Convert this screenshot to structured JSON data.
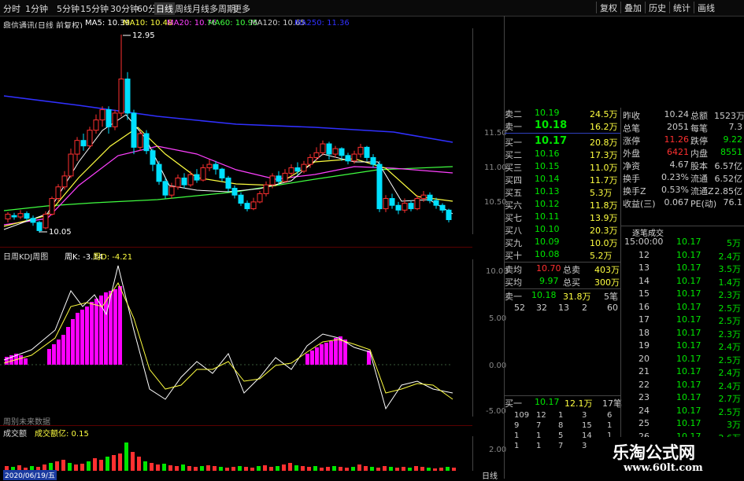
{
  "toolbar": {
    "periods": [
      "分时",
      "1分钟",
      "5分钟",
      "15分钟",
      "30分钟",
      "60分钟",
      "日线",
      "周线",
      "月线",
      "多周期",
      "更多"
    ],
    "active_period": "日线",
    "right_buttons": [
      "复权",
      "叠加",
      "历史",
      "统计",
      "画线"
    ]
  },
  "main_chart": {
    "title": "鼎信通讯(日线 前复权)",
    "ma_labels": [
      {
        "text": "MA5: 10.39",
        "color": "#ffffff"
      },
      {
        "text": "MA10: 10.48",
        "color": "#ffff40"
      },
      {
        "text": "MA20: 10.76",
        "color": "#ff40ff"
      },
      {
        "text": "MA60: 10.95",
        "color": "#40ff40"
      },
      {
        "text": "MA120: 10.65",
        "color": "#cccccc"
      },
      {
        "text": "MA250: 11.36",
        "color": "#3030ff"
      }
    ],
    "high_label": "12.95",
    "low_label": "10.05",
    "y_ticks": [
      "11.50",
      "11.00",
      "10.50"
    ],
    "colors": {
      "up": "#ff3030",
      "down": "#00e0ff",
      "ma5": "#ffffff",
      "ma10": "#ffff40",
      "ma20": "#ff40ff",
      "ma60": "#40ff40",
      "ma250": "#3030ff"
    }
  },
  "kdj": {
    "title": "日周KDJ周图",
    "k_label": "周K: -3.14",
    "d_label": "周D: -4.21",
    "y_ticks": [
      "10.00",
      "5.00",
      "0.00",
      "-5.00"
    ],
    "footer": "周别未来数据"
  },
  "volume": {
    "title": "成交额",
    "sub_label": "成交额亿: 0.15",
    "y_tick": "2.00",
    "date_label": "2020/06/19/五"
  },
  "order_book": {
    "asks": [
      {
        "label": "卖二",
        "price": "10.19",
        "vol": "24.5万"
      },
      {
        "label": "卖一",
        "price": "10.18",
        "vol": "16.2万"
      }
    ],
    "bids": [
      {
        "label": "买一",
        "price": "10.17",
        "vol": "20.8万"
      },
      {
        "label": "买二",
        "price": "10.16",
        "vol": "17.3万"
      },
      {
        "label": "买三",
        "price": "10.15",
        "vol": "11.0万"
      },
      {
        "label": "买四",
        "price": "10.14",
        "vol": "11.7万"
      },
      {
        "label": "买五",
        "price": "10.13",
        "vol": "5.3万"
      },
      {
        "label": "买六",
        "price": "10.12",
        "vol": "11.8万"
      },
      {
        "label": "买七",
        "price": "10.11",
        "vol": "13.9万"
      },
      {
        "label": "买八",
        "price": "10.10",
        "vol": "20.3万"
      },
      {
        "label": "买九",
        "price": "10.09",
        "vol": "10.0万"
      },
      {
        "label": "买十",
        "price": "10.08",
        "vol": "5.2万"
      }
    ],
    "avg_sell": {
      "label": "卖均",
      "price": "10.70",
      "tot_label": "总卖",
      "tot": "403万"
    },
    "avg_buy": {
      "label": "买均",
      "price": "9.97",
      "tot_label": "总买",
      "tot": "300万"
    },
    "queue_sell": {
      "label": "卖一",
      "price": "10.18",
      "vol": "31.8万",
      "cnt": "5笔"
    },
    "queue_sell_nums": [
      "52",
      "32",
      "13",
      "2",
      "60"
    ],
    "queue_buy": {
      "label": "买一",
      "price": "10.17",
      "vol": "12.1万",
      "cnt": "17笔"
    },
    "queue_buy_rows": [
      [
        "109",
        "12",
        "1",
        "3",
        "6"
      ],
      [
        "9",
        "7",
        "8",
        "15",
        "1"
      ],
      [
        "1",
        "1",
        "5",
        "14",
        "1"
      ],
      [
        "1",
        "1",
        "7",
        "3",
        "1"
      ]
    ]
  },
  "stats": [
    {
      "l1": "昨收",
      "v1": "10.24",
      "l2": "总额",
      "v2": "1523万"
    },
    {
      "l1": "总笔",
      "v1": "2051",
      "l2": "每笔",
      "v2": "7.3"
    },
    {
      "l1": "涨停",
      "v1": "11.26",
      "l2": "跌停",
      "v2": "9.22"
    },
    {
      "l1": "外盘",
      "v1": "6421",
      "l2": "内盘",
      "v2": "8551"
    },
    {
      "l1": "净资",
      "v1": "4.67",
      "l2": "股本",
      "v2": "6.57亿"
    },
    {
      "l1": "换手",
      "v1": "0.23%",
      "l2": "流通",
      "v2": "6.52亿"
    },
    {
      "l1": "换手Z",
      "v1": "0.53%",
      "l2": "流通Z",
      "v2": "2.85亿"
    },
    {
      "l1": "收益(三)",
      "v1": "0.067",
      "l2": "PE(动)",
      "v2": "76.1"
    }
  ],
  "ticks": {
    "title": "逐笔成交",
    "rows": [
      {
        "t": "15:00:00",
        "p": "10.17",
        "v": "5万"
      },
      {
        "t": "12",
        "p": "10.17",
        "v": "2.4万"
      },
      {
        "t": "13",
        "p": "10.17",
        "v": "3.5万"
      },
      {
        "t": "14",
        "p": "10.17",
        "v": "1.4万"
      },
      {
        "t": "15",
        "p": "10.17",
        "v": "2.3万"
      },
      {
        "t": "16",
        "p": "10.17",
        "v": "2.5万"
      },
      {
        "t": "17",
        "p": "10.17",
        "v": "2.5万"
      },
      {
        "t": "18",
        "p": "10.17",
        "v": "2.3万"
      },
      {
        "t": "19",
        "p": "10.17",
        "v": "2.4万"
      },
      {
        "t": "20",
        "p": "10.17",
        "v": "2.5万"
      },
      {
        "t": "21",
        "p": "10.17",
        "v": "2.4万"
      },
      {
        "t": "22",
        "p": "10.17",
        "v": "2.4万"
      },
      {
        "t": "23",
        "p": "10.17",
        "v": "2.7万"
      },
      {
        "t": "24",
        "p": "10.17",
        "v": "2.5万"
      },
      {
        "t": "25",
        "p": "10.17",
        "v": "3万"
      },
      {
        "t": "26",
        "p": "10.17",
        "v": "2.6万"
      }
    ]
  },
  "watermark": {
    "title": "乐淘公式网",
    "url": "www.60lt.com"
  },
  "bottom_tab": "日线"
}
